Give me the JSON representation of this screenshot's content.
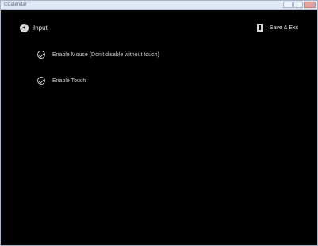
{
  "window": {
    "title": "CCalendar",
    "controls": [
      "minimize",
      "maximize",
      "close"
    ]
  },
  "header": {
    "icon": "back-arrow-icon",
    "title": "Input"
  },
  "actions": {
    "save_icon": "save-exit-icon",
    "save_label": "Save & Exit"
  },
  "options": [
    {
      "label": "Enable Mouse (Don't disable without touch)",
      "checked": true,
      "icon": "checkmark-icon"
    },
    {
      "label": "Enable Touch",
      "checked": true,
      "icon": "checkmark-icon"
    }
  ],
  "colors": {
    "background": "#000000",
    "text": "#e0e0e0",
    "titlebar": "#dfe8f4",
    "close_button": "#e0a49d"
  }
}
